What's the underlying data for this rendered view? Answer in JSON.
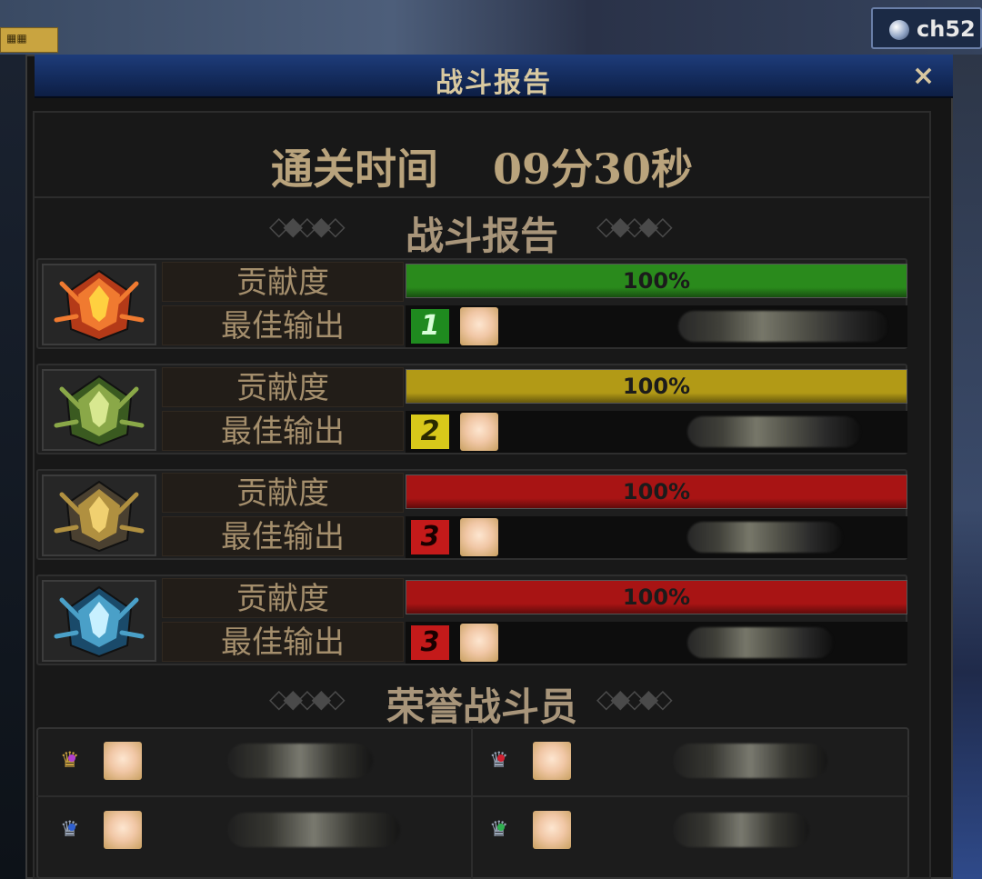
{
  "window": {
    "title": "战斗报告",
    "close_symbol": "×"
  },
  "top_hud": {
    "channel_label": "ch52"
  },
  "clear_time": {
    "label": "通关时间",
    "value": "09分30秒"
  },
  "report_section_title": "战斗报告",
  "honor_section_title": "荣誉战斗员",
  "players": [
    {
      "emblem": "flame-helm-emblem",
      "contribution_label": "贡献度",
      "contribution_pct": 100,
      "contribution_text": "100%",
      "bar_color": "#2a8a1c",
      "best_output_label": "最佳输出",
      "rank": "1",
      "rank_bg": "#1f8a1f",
      "rank_color": "#d8ffd8"
    },
    {
      "emblem": "leaf-helm-emblem",
      "contribution_label": "贡献度",
      "contribution_pct": 100,
      "contribution_text": "100%",
      "bar_color": "#b29a16",
      "best_output_label": "最佳输出",
      "rank": "2",
      "rank_bg": "#d8c81a",
      "rank_color": "#2a2a00"
    },
    {
      "emblem": "gold-helm-emblem",
      "contribution_label": "贡献度",
      "contribution_pct": 100,
      "contribution_text": "100%",
      "bar_color": "#a81414",
      "best_output_label": "最佳输出",
      "rank": "3",
      "rank_bg": "#c41a1a",
      "rank_color": "#1a0000"
    },
    {
      "emblem": "ice-helm-emblem",
      "contribution_label": "贡献度",
      "contribution_pct": 100,
      "contribution_text": "100%",
      "bar_color": "#a81414",
      "best_output_label": "最佳输出",
      "rank": "3",
      "rank_bg": "#c41a1a",
      "rank_color": "#1a0000"
    }
  ],
  "honor_members": [
    {
      "crown": "gold-crown-icon",
      "gem_color": "#b040d0"
    },
    {
      "crown": "silver-crown-icon",
      "gem_color": "#d02030"
    },
    {
      "crown": "silver-crown-icon",
      "gem_color": "#3060d0"
    },
    {
      "crown": "silver-crown-icon",
      "gem_color": "#30b050"
    }
  ]
}
